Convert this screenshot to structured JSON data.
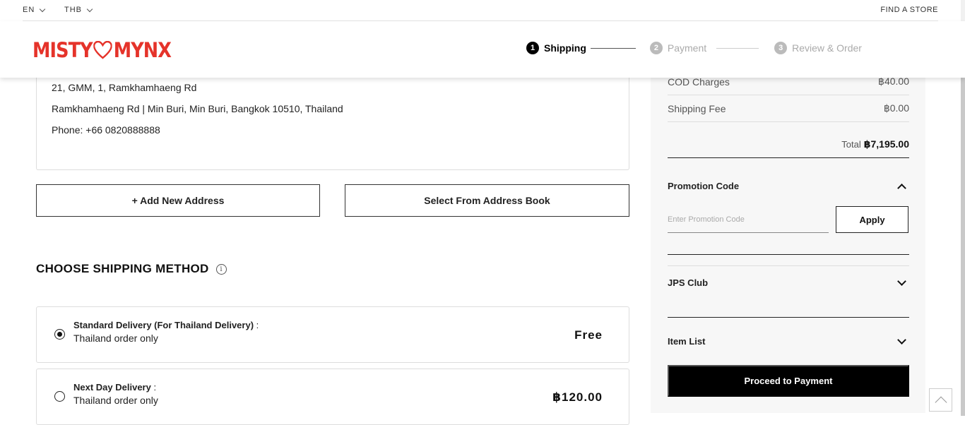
{
  "topbar": {
    "language": "EN",
    "currency": "THB",
    "find_store": "FIND A STORE"
  },
  "header": {
    "logo_left": "MISTY",
    "logo_right": "MYNX",
    "logo_heart_color": "#e5332a",
    "steps": [
      {
        "num": "1",
        "label": "Shipping",
        "state": "active"
      },
      {
        "num": "2",
        "label": "Payment",
        "state": "inactive"
      },
      {
        "num": "3",
        "label": "Review & Order",
        "state": "inactive"
      }
    ]
  },
  "address": {
    "line1": "21, GMM, 1, Ramkhamhaeng Rd",
    "line2": "Ramkhamhaeng Rd | Min Buri, Min Buri, Bangkok 10510, Thailand",
    "phone": "Phone: +66 0820888888"
  },
  "address_actions": {
    "add_new": "+ Add New Address",
    "select_book": "Select From Address Book"
  },
  "shipping": {
    "title": "CHOOSE SHIPPING METHOD",
    "info_icon": "info-icon",
    "options": [
      {
        "name": "Standard Delivery (For Thailand Delivery)",
        "colon": " :",
        "sub": "Thailand order only",
        "price": "Free",
        "selected": true
      },
      {
        "name": "Next Day Delivery",
        "colon": " :",
        "sub": "Thailand order only",
        "price": "฿120.00",
        "selected": false
      }
    ]
  },
  "summary": {
    "rows": [
      {
        "label": "COD Charges",
        "value": "฿40.00"
      },
      {
        "label": "Shipping Fee",
        "value": "฿0.00"
      }
    ],
    "total_label": "Total",
    "total_value": "฿7,195.00",
    "promo": {
      "title": "Promotion Code",
      "placeholder": "Enter Promotion Code",
      "apply": "Apply"
    },
    "jps_club": "JPS Club",
    "item_list": "Item List",
    "proceed": "Proceed to Payment"
  },
  "colors": {
    "brand": "#e5332a",
    "primary_button": "#000000",
    "panel_bg": "#f7f7f7"
  }
}
